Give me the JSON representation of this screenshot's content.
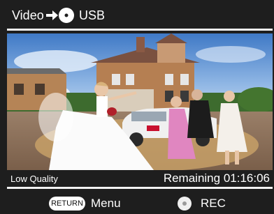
{
  "header": {
    "source_label": "Video",
    "arrow_icon": "disc-arrow-icon",
    "destination_label": "USB"
  },
  "preview": {
    "description_icon": "video-preview"
  },
  "status": {
    "quality": "Low Quality",
    "remaining": "Remaining 01:16:06"
  },
  "footer": {
    "return_key": "RETURN",
    "menu_label": "Menu",
    "rec_icon": "record-button-icon",
    "rec_label": "REC"
  },
  "colors": {
    "background": "#1e1e1e",
    "text": "#ffffff",
    "rule": "#f2f2f2"
  }
}
